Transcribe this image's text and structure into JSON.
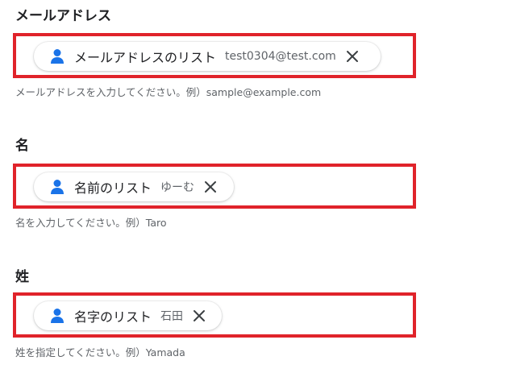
{
  "fields": [
    {
      "label": "メールアドレス",
      "chip_label": "メールアドレスのリスト",
      "chip_value": "test0304@test.com",
      "help": "メールアドレスを入力してください。例）sample@example.com"
    },
    {
      "label": "名",
      "chip_label": "名前のリスト",
      "chip_value": "ゆーむ",
      "help": "名を入力してください。例）Taro"
    },
    {
      "label": "姓",
      "chip_label": "名字のリスト",
      "chip_value": "石田",
      "help": "姓を指定してください。例）Yamada"
    }
  ],
  "icons": {
    "chip": "person-icon",
    "remove": "close-icon"
  },
  "colors": {
    "highlight": "#e0232a",
    "person_icon": "#1a73e8",
    "text": "#202124",
    "muted": "#5f6368"
  }
}
